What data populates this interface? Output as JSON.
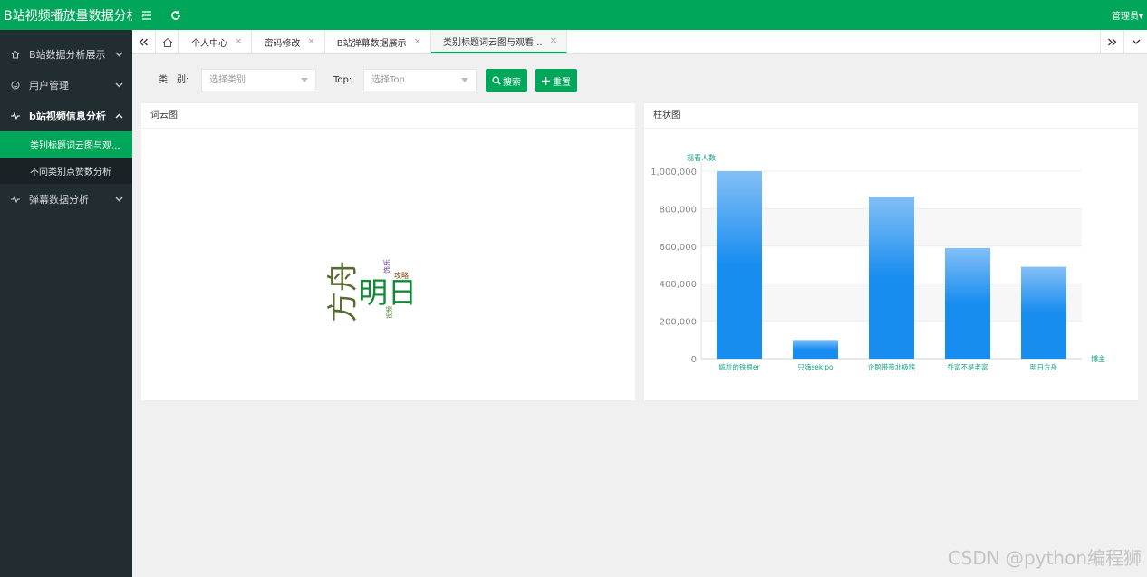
{
  "header": {
    "title": "B站视频播放量数据分析可视化",
    "user": "管理员▾"
  },
  "sidebar": {
    "items": [
      {
        "label": "B站数据分析展示",
        "icon": "home-icon"
      },
      {
        "label": "用户管理",
        "icon": "smile-icon"
      },
      {
        "label": "b站视频信息分析",
        "icon": "pulse-icon"
      },
      {
        "label": "弹幕数据分析",
        "icon": "pulse-icon"
      }
    ],
    "submenu": [
      {
        "label": "类别标题词云图与观..."
      },
      {
        "label": "不同类别点赞数分析"
      }
    ]
  },
  "tabs": [
    {
      "label": "个人中心"
    },
    {
      "label": "密码修改"
    },
    {
      "label": "B站弹幕数据展示"
    },
    {
      "label": "类别标题词云图与观看..."
    }
  ],
  "filters": {
    "category_label": "类　别:",
    "category_placeholder": "选择类别",
    "top_label": "Top:",
    "top_placeholder": "选择Top",
    "search_label": "搜索",
    "reset_label": "重置"
  },
  "wordcloud": {
    "title": "词云图",
    "words": [
      {
        "text": "方舟",
        "color": "#556b2f"
      },
      {
        "text": "明日",
        "color": "#138a36"
      },
      {
        "text": "攻略",
        "color": "#8b4513"
      },
      {
        "text": "饰乐",
        "color": "#6b3fa0"
      },
      {
        "text": "视频",
        "color": "#4b7d2a"
      }
    ]
  },
  "chart_data": {
    "type": "bar",
    "title": "柱状图",
    "ylabel": "观看人数",
    "xlabel": "博主",
    "categories": [
      "尴尬的铁根er",
      "只嗨sekipo",
      "企鹅带带北极熊",
      "乔富不是老富",
      "明日方舟"
    ],
    "values": [
      1000000,
      100000,
      865000,
      590000,
      490000
    ],
    "ylim": [
      0,
      1000000
    ],
    "yticks": [
      "0",
      "200,000",
      "400,000",
      "600,000",
      "800,000",
      "1,000,000"
    ],
    "grid": true,
    "bar_color": "#1a8ae8"
  },
  "watermark": "CSDN @python编程狮"
}
